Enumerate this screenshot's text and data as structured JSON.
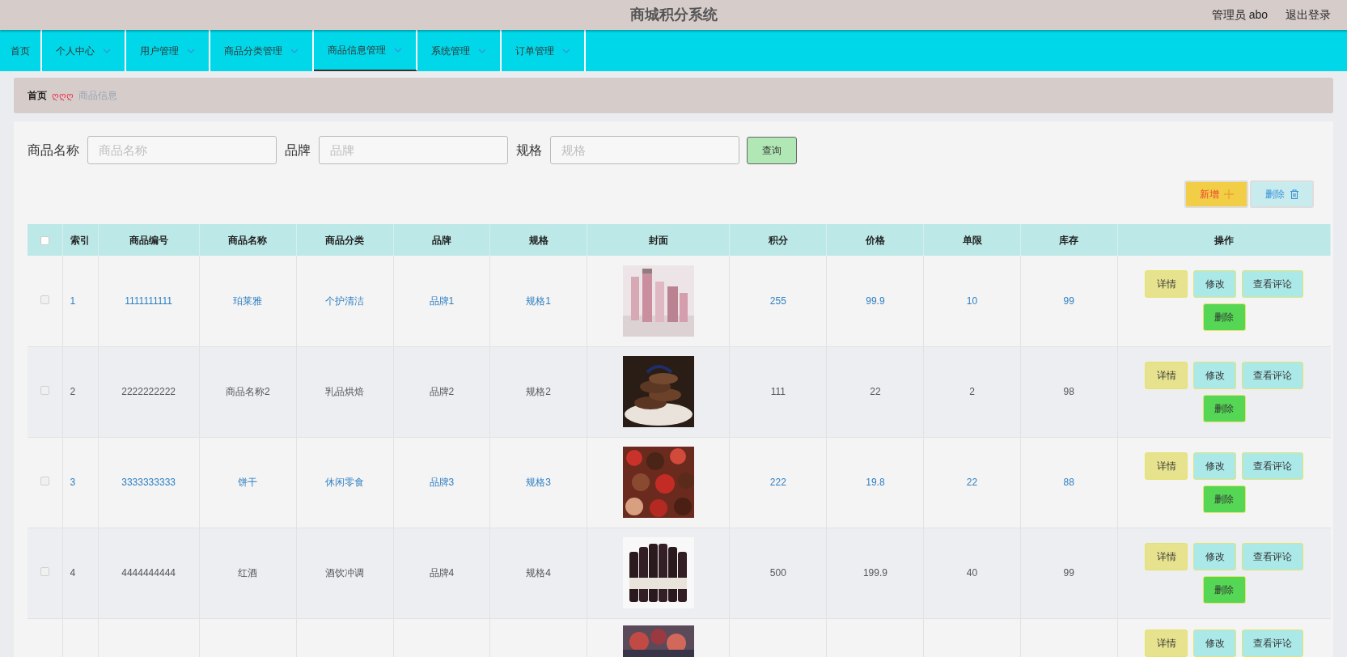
{
  "header": {
    "title": "商城积分系统",
    "user": "管理员 abo",
    "logout": "退出登录"
  },
  "nav": [
    {
      "label": "首页",
      "dropdown": false,
      "selected": false
    },
    {
      "label": "个人中心",
      "dropdown": true,
      "selected": false
    },
    {
      "label": "用户管理",
      "dropdown": true,
      "selected": false
    },
    {
      "label": "商品分类管理",
      "dropdown": true,
      "selected": false
    },
    {
      "label": "商品信息管理",
      "dropdown": true,
      "selected": true
    },
    {
      "label": "系统管理",
      "dropdown": true,
      "selected": false
    },
    {
      "label": "订单管理",
      "dropdown": true,
      "selected": false
    }
  ],
  "breadcrumb": {
    "home": "首页",
    "separator": "ღღღ",
    "current": "商品信息"
  },
  "search": [
    {
      "label": "商品名称",
      "placeholder": "商品名称"
    },
    {
      "label": "品牌",
      "placeholder": "品牌"
    },
    {
      "label": "规格",
      "placeholder": "规格"
    }
  ],
  "search_button": "查询",
  "toolbar": [
    {
      "kind": "add",
      "label": "新增"
    },
    {
      "kind": "delete",
      "label": "删除"
    }
  ],
  "table": {
    "header_checkbox": {
      "checked": false
    },
    "columns": [
      "索引",
      "商品编号",
      "商品名称",
      "商品分类",
      "品牌",
      "规格",
      "封面",
      "积分",
      "价格",
      "单限",
      "库存",
      "操作"
    ],
    "rows": [
      {
        "checked": false,
        "accent": true,
        "cells": [
          "1",
          "1111111111",
          "珀莱雅",
          "个护清洁",
          "品牌1",
          "规格1"
        ],
        "cover": {
          "kind": "picture"
        },
        "cells_after": [
          "255",
          "99.9",
          "10",
          "99"
        ],
        "actions": [
          {
            "kind": "detail",
            "label": "详情"
          },
          {
            "kind": "edit",
            "label": "修改"
          },
          {
            "kind": "review",
            "label": "查看评论"
          },
          {
            "kind": "delete",
            "label": "删除"
          }
        ]
      },
      {
        "checked": false,
        "accent": false,
        "cells": [
          "2",
          "2222222222",
          "商品名称2",
          "乳品烘焙",
          "品牌2",
          "规格2"
        ],
        "cover": {
          "kind": "picture"
        },
        "cells_after": [
          "111",
          "22",
          "2",
          "98"
        ],
        "actions": [
          {
            "kind": "detail",
            "label": "详情"
          },
          {
            "kind": "edit",
            "label": "修改"
          },
          {
            "kind": "review",
            "label": "查看评论"
          },
          {
            "kind": "delete",
            "label": "删除"
          }
        ]
      },
      {
        "checked": false,
        "accent": true,
        "cells": [
          "3",
          "3333333333",
          "饼干",
          "休闲零食",
          "品牌3",
          "规格3"
        ],
        "cover": {
          "kind": "picture"
        },
        "cells_after": [
          "222",
          "19.8",
          "22",
          "88"
        ],
        "actions": [
          {
            "kind": "detail",
            "label": "详情"
          },
          {
            "kind": "edit",
            "label": "修改"
          },
          {
            "kind": "review",
            "label": "查看评论"
          },
          {
            "kind": "delete",
            "label": "删除"
          }
        ]
      },
      {
        "checked": false,
        "accent": false,
        "cells": [
          "4",
          "4444444444",
          "红酒",
          "酒饮冲调",
          "品牌4",
          "规格4"
        ],
        "cover": {
          "kind": "picture"
        },
        "cells_after": [
          "500",
          "199.9",
          "40",
          "99"
        ],
        "actions": [
          {
            "kind": "detail",
            "label": "详情"
          },
          {
            "kind": "edit",
            "label": "修改"
          },
          {
            "kind": "review",
            "label": "查看评论"
          },
          {
            "kind": "delete",
            "label": "删除"
          }
        ]
      },
      {
        "cover": {
          "kind": "picture"
        },
        "actions": [
          {
            "kind": "detail",
            "label": "详情"
          },
          {
            "kind": "edit",
            "label": "修改"
          },
          {
            "kind": "review",
            "label": "查看评论"
          }
        ]
      }
    ]
  }
}
